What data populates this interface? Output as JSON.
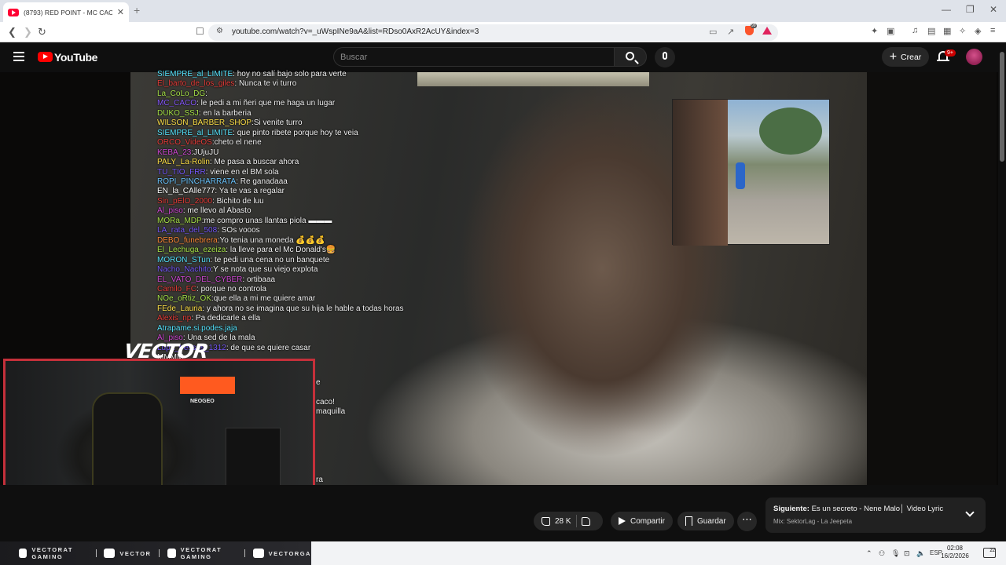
{
  "browser": {
    "tab_title": "(8793) RED POINT - MC CACO",
    "url": "youtube.com/watch?v=_uWspINe9aA&list=RDso0AxR2AcUY&index=3"
  },
  "youtube": {
    "logo_text": "YouTube",
    "search_placeholder": "Buscar",
    "create_label": "Crear",
    "notification_count": "9+"
  },
  "chat": {
    "messages": [
      {
        "user": "SIEMPRE_al_LIMITE",
        "text": ": hoy no salí bajo solo para verte",
        "color": "#58e6ff"
      },
      {
        "user": "El_barto_de_los_giles",
        "text": ": Nunca te vi turro",
        "color": "#e8403c"
      },
      {
        "user": "La_CoLo_DG",
        "text": ":",
        "color": "#a8e34a"
      },
      {
        "user": "MC_CACO",
        "text": ": le pedi a mi ñeri que me haga un lugar",
        "color": "#8a5cff"
      },
      {
        "user": "DUKO_SSJ",
        "text": ": en la barberia",
        "color": "#a8e34a"
      },
      {
        "user": "WILSON_BARBER_SHOP",
        "text": ":Si venite turro",
        "color": "#ffe14a"
      },
      {
        "user": "SIEMPRE_al_LIMITE",
        "text": ": que pinto ribete porque hoy te veia",
        "color": "#58e6ff"
      },
      {
        "user": "ORCO_VideOS",
        "text": ":cheto el nene",
        "color": "#e8403c"
      },
      {
        "user": "KEBA_23",
        "text": ":JUjuJU",
        "color": "#d24ad6"
      },
      {
        "user": "PALY_La-Rolin",
        "text": ": Me pasa a buscar ahora",
        "color": "#ffe14a"
      },
      {
        "user": "TU_TIO_FRR",
        "text": ": viene en el BM sola",
        "color": "#7a5cff"
      },
      {
        "user": "ROPI_PINCHARRATA",
        "text": ": Re ganadaaa",
        "color": "#6cc6ff"
      },
      {
        "user": "EN_la_CAlle777",
        "text": ": Ya te vas a regalar",
        "color": "#ffffff"
      },
      {
        "user": "Sin_pElO_2000",
        "text": ": Bichito de luu",
        "color": "#e8403c"
      },
      {
        "user": "Al_piso",
        "text": ": me llevo al Abasto",
        "color": "#d24ad6"
      },
      {
        "user": "MORa_MDP",
        "text": ":me compro unas llantas piola ▬▬▬",
        "color": "#a8e34a"
      },
      {
        "user": "LA_rata_del_508",
        "text": ": SOs vooos",
        "color": "#7a5cff"
      },
      {
        "user": "DEBO_funebrera",
        "text": ":Yo tenia una moneda 💰💰💰",
        "color": "#ff8a3a"
      },
      {
        "user": "El_Lechuga_ezeiza",
        "text": ": la lleve para el Mc Donald's🍔",
        "color": "#a8e34a"
      },
      {
        "user": "MORON_STun",
        "text": ": te pedi una cena no un banquete",
        "color": "#58e6ff"
      },
      {
        "user": "Nacho_Nachito",
        "text": ":Y se nota que su viejo explota",
        "color": "#7a5cff"
      },
      {
        "user": "EL_VATO_DEL_CYBER",
        "text": ": ortibaaa",
        "color": "#d24ad6"
      },
      {
        "user": "Camilo_FC",
        "text": ": porque no controla",
        "color": "#e8403c"
      },
      {
        "user": "NOe_oRtiz_OK",
        "text": ":que ella a mi me quiere amar",
        "color": "#a8e34a"
      },
      {
        "user": "FEde_Lauria",
        "text": ": y ahora no se imagina que su hija le hable a todas horas",
        "color": "#ffe14a"
      },
      {
        "user": "Alexis_np",
        "text": ": Pa dedicarle a ella",
        "color": "#e8403c"
      },
      {
        "user": "Atrapame.si.podes.jaja",
        "text": "",
        "color": "#58e6ff"
      },
      {
        "user": "Al_piso",
        "text": ": Una sed de la mala",
        "color": "#d24ad6"
      },
      {
        "user": "Lupa_tresses_1312",
        "text": ": de que se quiere casar",
        "color": "#7a5cff"
      },
      {
        "user": "",
        "text": "MMMM",
        "color": "#ffffff"
      }
    ],
    "overflow_lines": [
      "e",
      "",
      "caco!",
      "maquilla",
      "",
      "",
      "",
      "",
      "",
      "",
      "ra"
    ]
  },
  "overlay": {
    "logo_text": "VECTOR",
    "facecam_label": "NEOGEO",
    "banner": [
      {
        "icon": "youtube-icon",
        "label": "VECTORAT GAMING"
      },
      {
        "icon": "twitch-icon",
        "label": "VECTOR"
      },
      {
        "icon": "twitter-icon",
        "label": "VECTORAT GAMING"
      },
      {
        "icon": "instagram-icon",
        "label": "VECTORGA"
      }
    ]
  },
  "actions": {
    "likes": "28 K",
    "share_label": "Compartir",
    "save_label": "Guardar"
  },
  "up_next": {
    "prefix": "Siguiente:",
    "title": "Es un secreto - Nene Malo│ Video Lyric",
    "subtitle": "Mix: SektorLag - La Jeepeta"
  },
  "taskbar": {
    "language": "ESP",
    "time": "02:08",
    "date": "16/2/2026",
    "notification_count": "22"
  }
}
